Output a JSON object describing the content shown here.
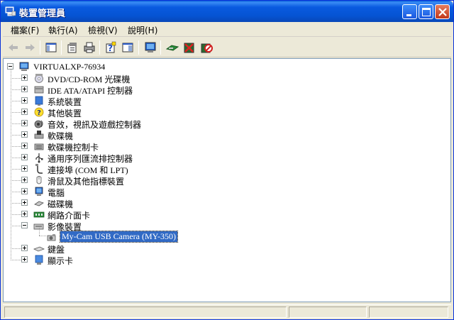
{
  "window": {
    "title": "裝置管理員"
  },
  "menu": [
    {
      "label": "檔案(F)"
    },
    {
      "label": "執行(A)"
    },
    {
      "label": "檢視(V)"
    },
    {
      "label": "說明(H)"
    }
  ],
  "toolbar": {
    "buttons": [
      "back-icon",
      "forward-icon",
      "show-hide-tree-icon",
      "properties-icon",
      "print-icon",
      "help-icon",
      "console-tree-icon",
      "computer-icon",
      "scan-hardware-icon",
      "uninstall-icon",
      "disable-icon"
    ]
  },
  "tree": {
    "root": "VIRTUALXP-76934",
    "categories": [
      {
        "label": "DVD/CD-ROM 光碟機",
        "icon": "dvd-icon"
      },
      {
        "label": "IDE ATA/ATAPI 控制器",
        "icon": "ide-controller-icon"
      },
      {
        "label": "系統裝置",
        "icon": "system-device-icon"
      },
      {
        "label": "其他裝置",
        "icon": "unknown-device-icon"
      },
      {
        "label": "音效，視訊及遊戲控制器",
        "icon": "sound-icon"
      },
      {
        "label": "軟碟機",
        "icon": "floppy-drive-icon"
      },
      {
        "label": "軟碟機控制卡",
        "icon": "floppy-controller-icon"
      },
      {
        "label": "通用序列匯流排控制器",
        "icon": "usb-icon"
      },
      {
        "label": "連接埠 (COM 和 LPT)",
        "icon": "port-icon"
      },
      {
        "label": "滑鼠及其他指標裝置",
        "icon": "mouse-icon"
      },
      {
        "label": "電腦",
        "icon": "computer-icon"
      },
      {
        "label": "磁碟機",
        "icon": "disk-drive-icon"
      },
      {
        "label": "網路介面卡",
        "icon": "network-adapter-icon"
      },
      {
        "label": "影像裝置",
        "icon": "imaging-device-icon"
      },
      {
        "label": "鍵盤",
        "icon": "keyboard-icon"
      },
      {
        "label": "顯示卡",
        "icon": "display-adapter-icon"
      }
    ],
    "selected_child": "My-Cam USB Camera (MY-350)"
  },
  "colors": {
    "titlebar": "#0554D4",
    "selection": "#316AC5",
    "chrome": "#ECE9D8"
  }
}
